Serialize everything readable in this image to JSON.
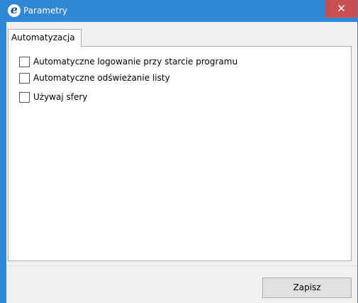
{
  "window": {
    "title": "Parametry",
    "close_label": "✕",
    "accent_color": "#2e88d6",
    "close_color": "#c75050"
  },
  "tabs": [
    {
      "label": "Automatyzacja",
      "selected": true
    }
  ],
  "options": [
    {
      "label": "Automatyczne logowanie przy starcie programu",
      "checked": false
    },
    {
      "label": "Automatyczne odświeżanie listy",
      "checked": false
    },
    {
      "label": "Używaj sfery",
      "checked": false
    }
  ],
  "footer": {
    "save_label": "Zapisz"
  },
  "icons": {
    "app": "app-logo-icon",
    "close": "close-icon"
  }
}
